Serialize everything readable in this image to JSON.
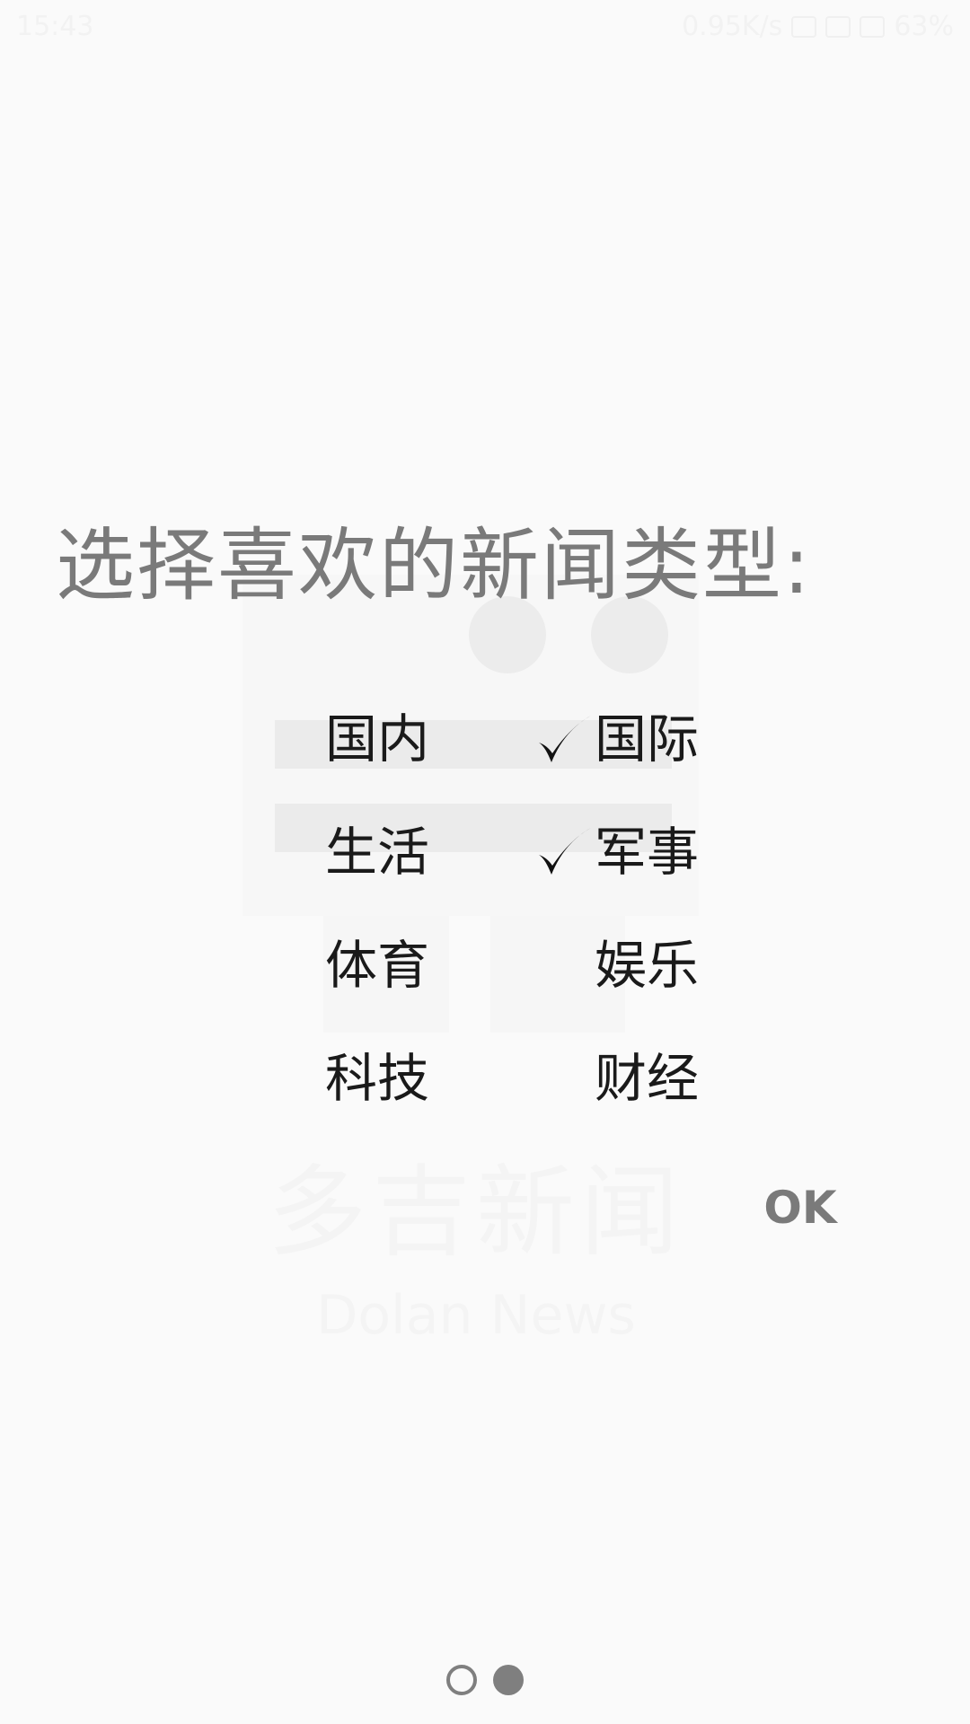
{
  "status_bar": {
    "time": "15:43",
    "net_speed": "0.95K/s",
    "battery": "63%"
  },
  "title": "选择喜欢的新闻类型:",
  "categories": [
    {
      "label": "国内",
      "checked": false
    },
    {
      "label": "国际",
      "checked": true
    },
    {
      "label": "生活",
      "checked": false
    },
    {
      "label": "军事",
      "checked": true
    },
    {
      "label": "体育",
      "checked": false
    },
    {
      "label": "娱乐",
      "checked": false
    },
    {
      "label": "科技",
      "checked": false
    },
    {
      "label": "财经",
      "checked": false
    }
  ],
  "ok_label": "OK",
  "background_logo": {
    "cn": "多吉新闻",
    "en": "Dolan News"
  },
  "pager": {
    "total": 2,
    "current": 2
  },
  "colors": {
    "background": "#fafafa",
    "title": "#7a7a7a",
    "category_text": "#1a1a1a",
    "checkmark": "#111111",
    "indicator": "#7f7f7f"
  }
}
